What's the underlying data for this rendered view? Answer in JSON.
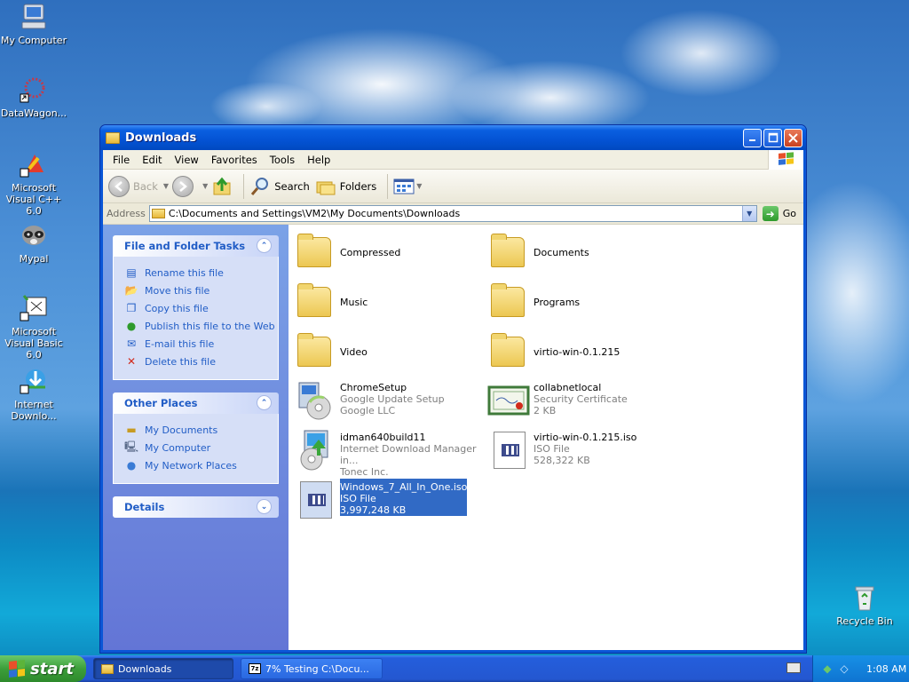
{
  "desktop": {
    "icons": [
      {
        "label": "My Computer"
      },
      {
        "label": "DataWagon..."
      },
      {
        "label": "Microsoft Visual C++ 6.0"
      },
      {
        "label": "Mypal"
      },
      {
        "label": "Microsoft Visual Basic 6.0"
      },
      {
        "label": "Internet Downlo..."
      },
      {
        "label": "Recycle Bin"
      }
    ]
  },
  "window": {
    "title": "Downloads",
    "menu": [
      "File",
      "Edit",
      "View",
      "Favorites",
      "Tools",
      "Help"
    ],
    "toolbar": {
      "back": "Back",
      "search": "Search",
      "folders": "Folders"
    },
    "address": {
      "label": "Address",
      "path": "C:\\Documents and Settings\\VM2\\My Documents\\Downloads",
      "go": "Go"
    },
    "task_pane": {
      "file_tasks": {
        "title": "File and Folder Tasks",
        "items": [
          "Rename this file",
          "Move this file",
          "Copy this file",
          "Publish this file to the Web",
          "E-mail this file",
          "Delete this file"
        ]
      },
      "other_places": {
        "title": "Other Places",
        "items": [
          "My Documents",
          "My Computer",
          "My Network Places"
        ]
      },
      "details": {
        "title": "Details"
      }
    },
    "files": [
      {
        "name": "Compressed",
        "kind": "folder"
      },
      {
        "name": "Documents",
        "kind": "folder"
      },
      {
        "name": "Music",
        "kind": "folder"
      },
      {
        "name": "Programs",
        "kind": "folder"
      },
      {
        "name": "Video",
        "kind": "folder"
      },
      {
        "name": "virtio-win-0.1.215",
        "kind": "folder"
      },
      {
        "name": "ChromeSetup",
        "line2": "Google Update Setup",
        "line3": "Google LLC"
      },
      {
        "name": "collabnetlocal",
        "line2": "Security Certificate",
        "line3": "2 KB"
      },
      {
        "name": "idman640build11",
        "line2": "Internet Download Manager in...",
        "line3": "Tonec Inc."
      },
      {
        "name": "virtio-win-0.1.215.iso",
        "line2": "ISO File",
        "line3": "528,322 KB"
      },
      {
        "name": "Windows_7_All_In_One.iso",
        "line2": "ISO File",
        "line3": "3,997,248 KB",
        "selected": true
      }
    ]
  },
  "taskbar": {
    "start": "start",
    "buttons": [
      {
        "label": "Downloads",
        "active": true
      },
      {
        "label": "7% Testing C:\\Docu...",
        "icon_text": "7z"
      }
    ],
    "clock": "1:08 AM"
  }
}
